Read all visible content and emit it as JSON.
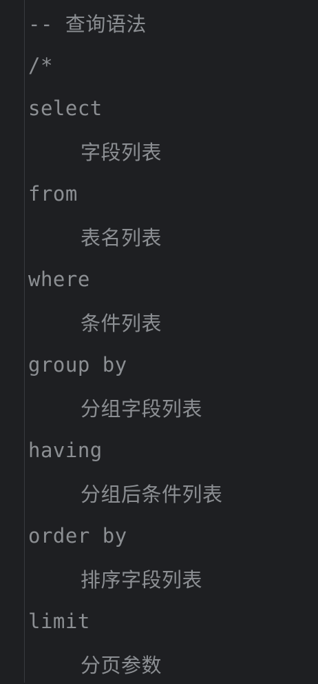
{
  "editor": {
    "lines": [
      {
        "text": "-- 查询语法",
        "indent": 0
      },
      {
        "text": "/*",
        "indent": 0
      },
      {
        "text": "select",
        "indent": 0
      },
      {
        "text": "字段列表",
        "indent": 1
      },
      {
        "text": "from",
        "indent": 0
      },
      {
        "text": "表名列表",
        "indent": 1
      },
      {
        "text": "where",
        "indent": 0
      },
      {
        "text": "条件列表",
        "indent": 1
      },
      {
        "text": "group by",
        "indent": 0
      },
      {
        "text": "分组字段列表",
        "indent": 1
      },
      {
        "text": "having",
        "indent": 0
      },
      {
        "text": "分组后条件列表",
        "indent": 1
      },
      {
        "text": "order by",
        "indent": 0
      },
      {
        "text": "排序字段列表",
        "indent": 1
      },
      {
        "text": "limit",
        "indent": 0
      },
      {
        "text": "分页参数",
        "indent": 1
      }
    ]
  },
  "colors": {
    "background": "#1e1f22",
    "comment_text": "#8c8f93",
    "indent_guide": "#393b40"
  }
}
